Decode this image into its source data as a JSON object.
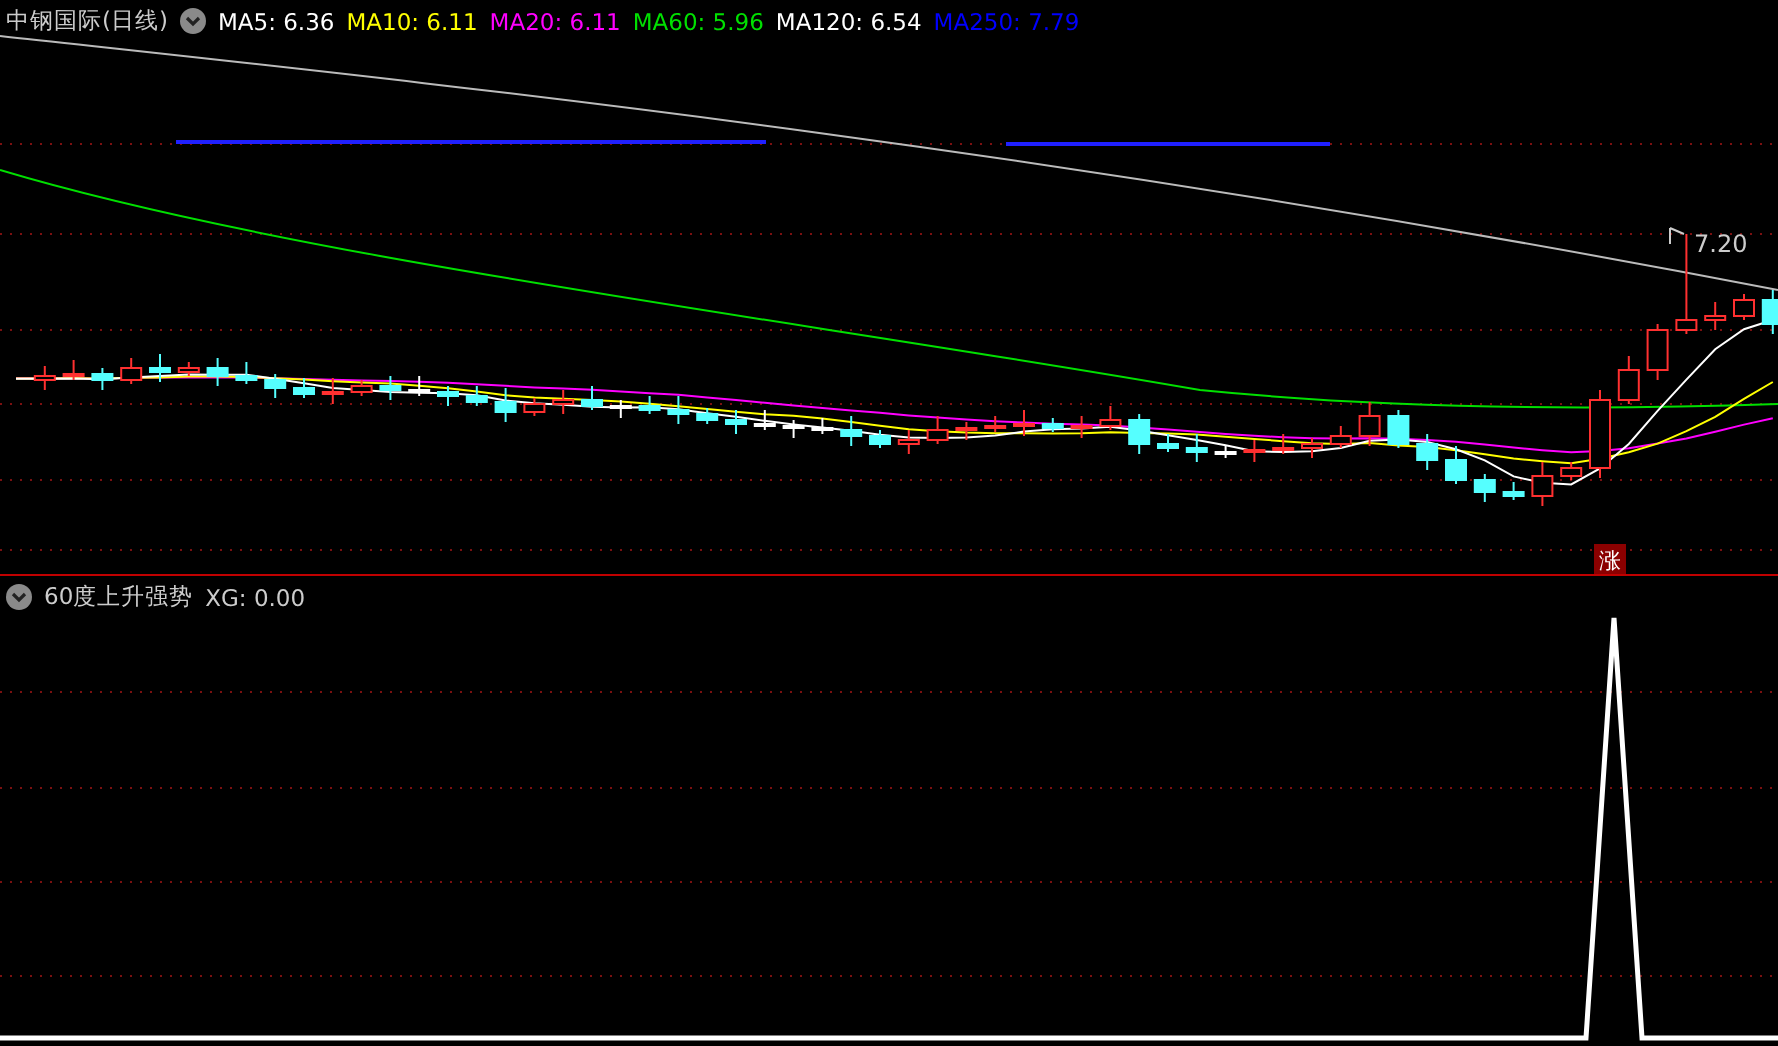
{
  "main_panel": {
    "title": "中钢国际(日线)",
    "legend": [
      {
        "label": "MA5: 6.36",
        "color": "#ffffff"
      },
      {
        "label": "MA10: 6.11",
        "color": "#ffff00"
      },
      {
        "label": "MA20: 6.11",
        "color": "#ff00ff"
      },
      {
        "label": "MA60: 5.96",
        "color": "#00e000"
      },
      {
        "label": "MA120: 6.54",
        "color": "#ffffff"
      },
      {
        "label": "MA250: 7.79",
        "color": "#0000ff"
      }
    ],
    "high_label": "7.20",
    "signal_badge": "涨"
  },
  "indicator_panel": {
    "title": "60度上升强势",
    "value": "XG: 0.00"
  }
}
